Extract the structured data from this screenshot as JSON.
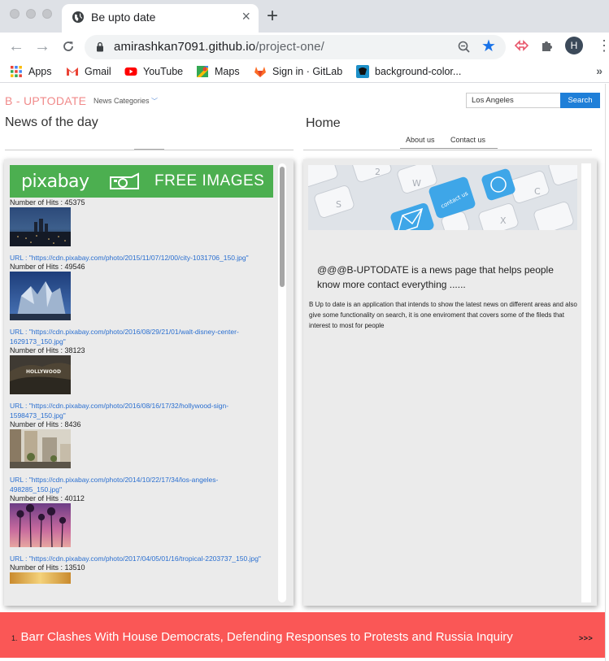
{
  "browser": {
    "tab_title": "Be upto date",
    "url_host": "amirashkan7091.github.io",
    "url_path": "/project-one/",
    "avatar_initial": "H",
    "bookmarks": [
      {
        "label": "Apps",
        "icon": "apps-grid-icon"
      },
      {
        "label": "Gmail",
        "icon": "gmail-icon"
      },
      {
        "label": "YouTube",
        "icon": "youtube-icon"
      },
      {
        "label": "Maps",
        "icon": "maps-icon"
      },
      {
        "label": "Sign in · GitLab",
        "icon": "gitlab-icon"
      },
      {
        "label": "background-color...",
        "icon": "css-tricks-icon"
      }
    ],
    "star_color": "#1a73e8"
  },
  "header": {
    "brand": "B - UPTODATE",
    "categories_label": "News Categories",
    "search_value": "Los Angeles",
    "search_button": "Search"
  },
  "left": {
    "title": "News of the day",
    "banner_logo": "pixabay",
    "banner_text": "FREE IMAGES",
    "items": [
      {
        "hits": "Number of Hits : 45375",
        "url": "URL : \"https://cdn.pixabay.com/photo/2015/11/07/12/00/city-1031706_150.jpg\""
      },
      {
        "hits": "Number of Hits : 49546",
        "url": "URL : \"https://cdn.pixabay.com/photo/2016/08/29/21/01/walt-disney-center-1629173_150.jpg\""
      },
      {
        "hits": "Number of Hits : 38123",
        "url": "URL : \"https://cdn.pixabay.com/photo/2016/08/16/17/32/hollywood-sign-1598473_150.jpg\""
      },
      {
        "hits": "Number of Hits : 8436",
        "url": "URL : \"https://cdn.pixabay.com/photo/2014/10/22/17/34/los-angeles-498285_150.jpg\""
      },
      {
        "hits": "Number of Hits : 40112",
        "url": "URL : \"https://cdn.pixabay.com/photo/2017/04/05/01/16/tropical-2203737_150.jpg\""
      },
      {
        "hits": "Number of Hits : 13510",
        "url": ""
      }
    ]
  },
  "right": {
    "title": "Home",
    "nav": [
      "About us",
      "Contact us"
    ],
    "image_text": "contact us",
    "tagline": "@@@B-UPTODATE is a news page that helps people know more contact everything ......",
    "description": "B Up to date is an application that intends to show the latest news on different areas and also give some functionality on search, it is one enviroment that covers some of the fileds that interest to most for people"
  },
  "ticker": {
    "number": "1.",
    "headline": "Barr Clashes With House Democrats, Defending Responses to Protests and Russia Inquiry",
    "more": ">>>",
    "color": "#fa5756"
  }
}
